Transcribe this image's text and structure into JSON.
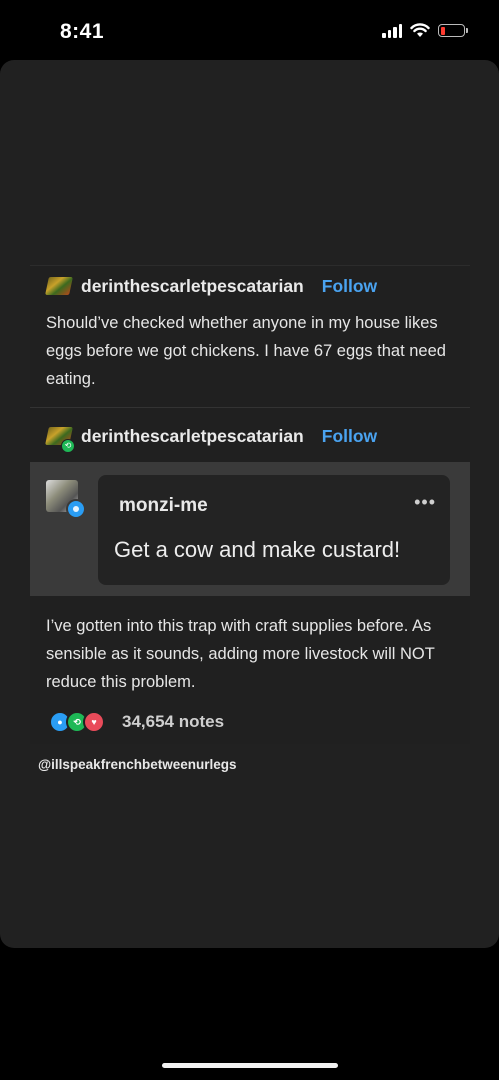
{
  "status_bar": {
    "time": "8:41",
    "battery_level": 0.1
  },
  "posts": [
    {
      "username": "derinthescarletpescatarian",
      "follow_label": "Follow",
      "text": "Should’ve checked whether anyone in my house likes eggs before we got chickens. I have 67 eggs that need eating."
    },
    {
      "username": "derinthescarletpescatarian",
      "follow_label": "Follow",
      "quote": {
        "username": "monzi-me",
        "text": "Get a cow and make custard!"
      },
      "text": "I’ve gotten into this trap with craft supplies before. As sensible as it sounds, adding more livestock will NOT reduce this problem.",
      "notes": "34,654 notes"
    }
  ],
  "credit": "@illspeakfrenchbetweenurlegs",
  "colors": {
    "follow": "#4aa3f0",
    "reblog_green": "#1eb856",
    "like_red": "#e94b5a",
    "reply_blue": "#2a9df4"
  },
  "icons": [
    "signal-icon",
    "wifi-icon",
    "battery-icon",
    "reblog-icon",
    "more-icon",
    "reply-icon",
    "like-icon"
  ]
}
